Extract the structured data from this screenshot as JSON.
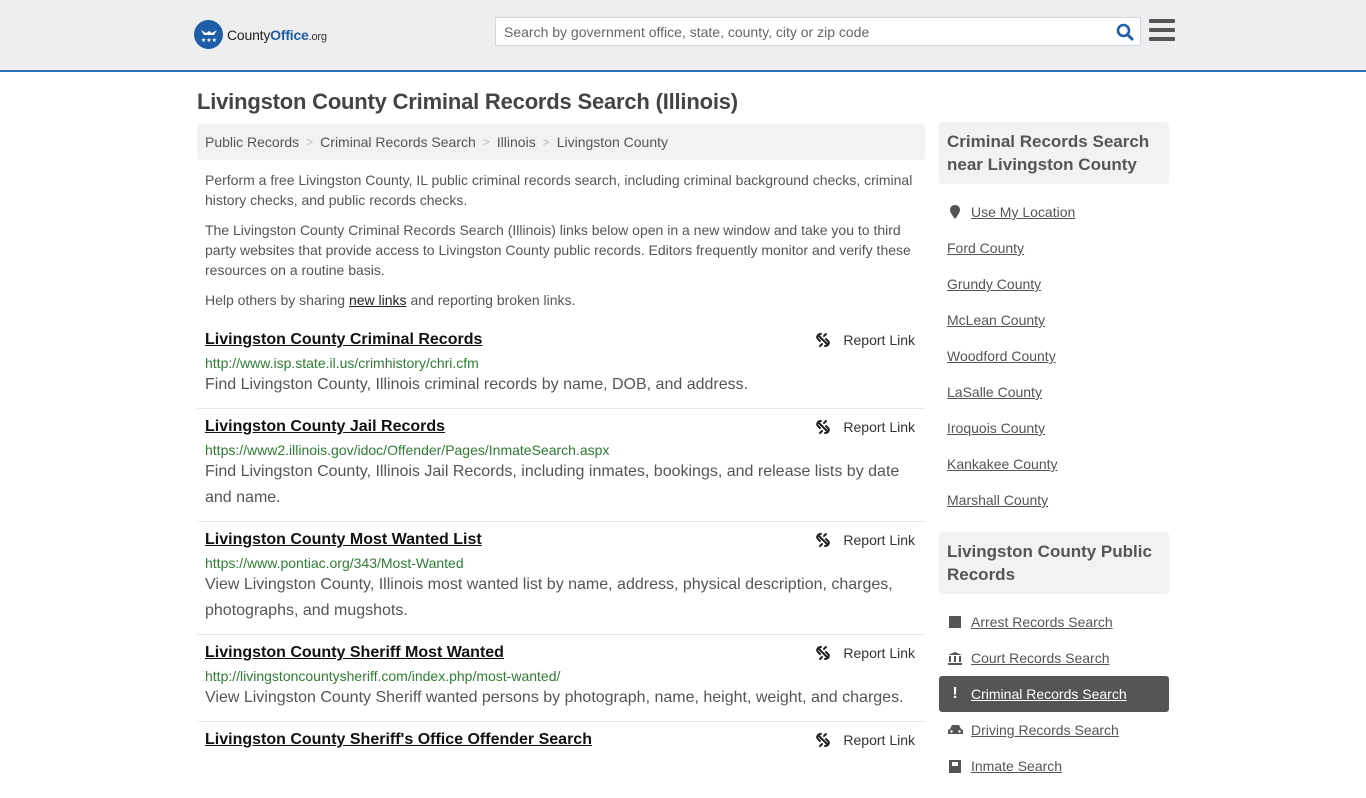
{
  "header": {
    "logo": {
      "name": "County",
      "name_bold": "Office",
      "suffix": ".org"
    },
    "search": {
      "placeholder": "Search by government office, state, county, city or zip code",
      "value": ""
    }
  },
  "page": {
    "title": "Livingston County Criminal Records Search (Illinois)",
    "breadcrumb": [
      "Public Records",
      "Criminal Records Search",
      "Illinois",
      "Livingston County"
    ],
    "intro": {
      "p1": "Perform a free Livingston County, IL public criminal records search, including criminal background checks, criminal history checks, and public records checks.",
      "p2": "The Livingston County Criminal Records Search (Illinois) links below open in a new window and take you to third party websites that provide access to Livingston County public records. Editors frequently monitor and verify these resources on a routine basis.",
      "p3_before": "Help others by sharing ",
      "p3_link": "new links",
      "p3_after": " and reporting broken links."
    },
    "report_label": "Report Link",
    "results": [
      {
        "title": "Livingston County Criminal Records",
        "url": "http://www.isp.state.il.us/crimhistory/chri.cfm",
        "desc": "Find Livingston County, Illinois criminal records by name, DOB, and address."
      },
      {
        "title": "Livingston County Jail Records",
        "url": "https://www2.illinois.gov/idoc/Offender/Pages/InmateSearch.aspx",
        "desc": "Find Livingston County, Illinois Jail Records, including inmates, bookings, and release lists by date and name."
      },
      {
        "title": "Livingston County Most Wanted List",
        "url": "https://www.pontiac.org/343/Most-Wanted",
        "desc": "View Livingston County, Illinois most wanted list by name, address, physical description, charges, photographs, and mugshots."
      },
      {
        "title": "Livingston County Sheriff Most Wanted",
        "url": "http://livingstoncountysheriff.com/index.php/most-wanted/",
        "desc": "View Livingston County Sheriff wanted persons by photograph, name, height, weight, and charges."
      },
      {
        "title": "Livingston County Sheriff's Office Offender Search",
        "url": "",
        "desc": ""
      }
    ]
  },
  "sidebar": {
    "nearby": {
      "heading": "Criminal Records Search near Livingston County",
      "use_location": "Use My Location",
      "items": [
        "Ford County",
        "Grundy County",
        "McLean County",
        "Woodford County",
        "LaSalle County",
        "Iroquois County",
        "Kankakee County",
        "Marshall County"
      ]
    },
    "public_records": {
      "heading": "Livingston County Public Records",
      "items": [
        {
          "label": "Arrest Records Search",
          "icon": "square-icon",
          "active": false
        },
        {
          "label": "Court Records Search",
          "icon": "courthouse-icon",
          "active": false
        },
        {
          "label": "Criminal Records Search",
          "icon": "exclamation-icon",
          "active": true
        },
        {
          "label": "Driving Records Search",
          "icon": "car-icon",
          "active": false
        },
        {
          "label": "Inmate Search",
          "icon": "inmate-icon",
          "active": false
        }
      ]
    }
  },
  "colors": {
    "brand": "#1e5ea8",
    "url_green": "#2e7d32",
    "active_bg": "#555555"
  }
}
